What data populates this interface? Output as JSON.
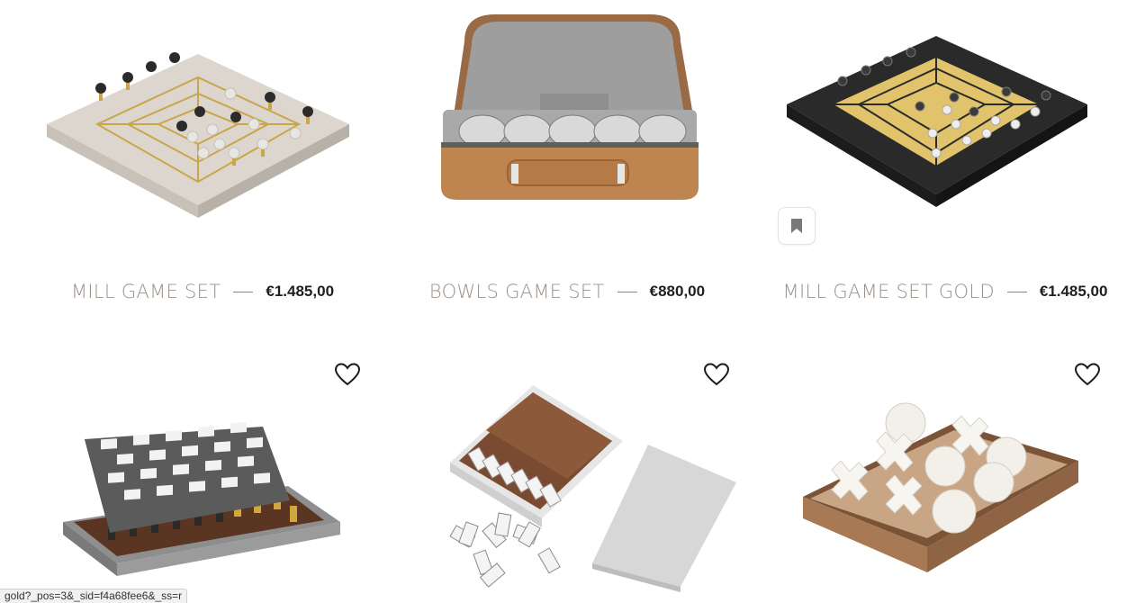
{
  "products": [
    {
      "name": "MILL GAME SET",
      "price": "€1.485,00"
    },
    {
      "name": "BOWLS GAME SET",
      "price": "€880,00"
    },
    {
      "name": "MILL GAME SET GOLD",
      "price": "€1.485,00"
    }
  ],
  "next_row": [
    {
      "image": "chess-set"
    },
    {
      "image": "domino-set"
    },
    {
      "image": "tic-tac-toe-set"
    }
  ],
  "status_url": "gold?_pos=3&_sid=f4a68fee6&_ss=r",
  "icons": {
    "wishlist": "heart-icon",
    "bookmark": "bookmark-icon"
  }
}
